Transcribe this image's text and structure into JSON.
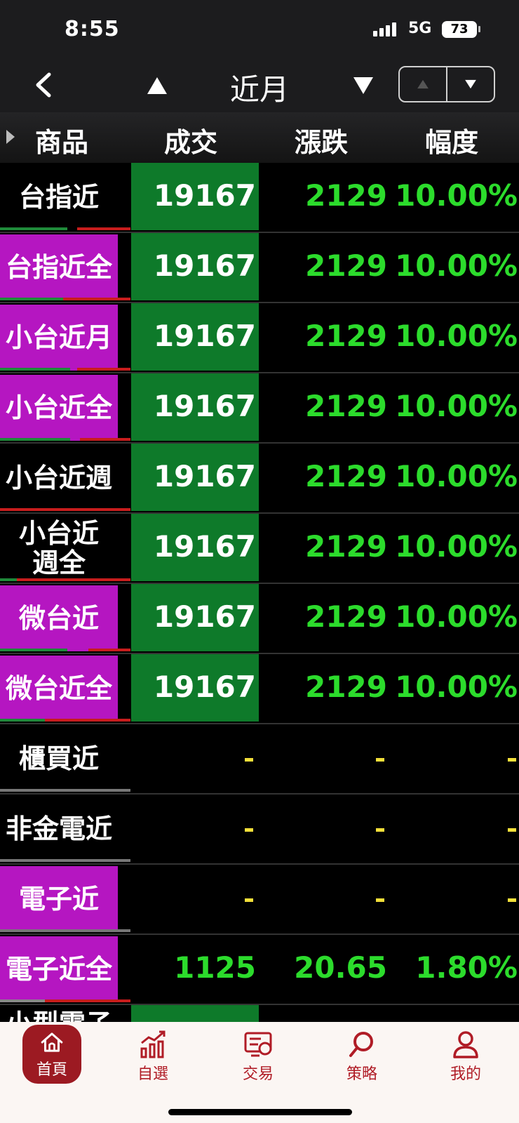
{
  "status": {
    "time": "8:55",
    "network": "5G",
    "battery": "73"
  },
  "nav": {
    "title": "近月"
  },
  "header": {
    "name": "商品",
    "price": "成交",
    "change": "漲跌",
    "percent": "幅度"
  },
  "rows": [
    {
      "name": "台指近",
      "price": "19167",
      "change": "2129",
      "percent": "10.00%"
    },
    {
      "name": "台指近全",
      "price": "19167",
      "change": "2129",
      "percent": "10.00%"
    },
    {
      "name": "小台近月",
      "price": "19167",
      "change": "2129",
      "percent": "10.00%"
    },
    {
      "name": "小台近全",
      "price": "19167",
      "change": "2129",
      "percent": "10.00%"
    },
    {
      "name": "小台近週",
      "price": "19167",
      "change": "2129",
      "percent": "10.00%"
    },
    {
      "name": "小台近週全",
      "price": "19167",
      "change": "2129",
      "percent": "10.00%"
    },
    {
      "name": "微台近",
      "price": "19167",
      "change": "2129",
      "percent": "10.00%"
    },
    {
      "name": "微台近全",
      "price": "19167",
      "change": "2129",
      "percent": "10.00%"
    },
    {
      "name": "櫃買近",
      "price": "-",
      "change": "-",
      "percent": "-"
    },
    {
      "name": "非金電近",
      "price": "-",
      "change": "-",
      "percent": "-"
    },
    {
      "name": "電子近",
      "price": "-",
      "change": "-",
      "percent": "-"
    },
    {
      "name": "電子近全",
      "price": "1125",
      "change": "20.65",
      "percent": "1.80%"
    },
    {
      "name": "小型電子",
      "price": "",
      "change": "",
      "percent": ""
    }
  ],
  "tabs": [
    {
      "label": "首頁",
      "icon": "home-icon"
    },
    {
      "label": "自選",
      "icon": "chart-icon"
    },
    {
      "label": "交易",
      "icon": "trade-icon"
    },
    {
      "label": "策略",
      "icon": "search-icon"
    },
    {
      "label": "我的",
      "icon": "user-icon"
    }
  ],
  "colors": {
    "purple": "#b516c1",
    "green_cell": "#0e7a2a",
    "green_text": "#2cdc2c",
    "yellow_dash": "#f4e03a",
    "brand_red": "#9c1a22"
  }
}
